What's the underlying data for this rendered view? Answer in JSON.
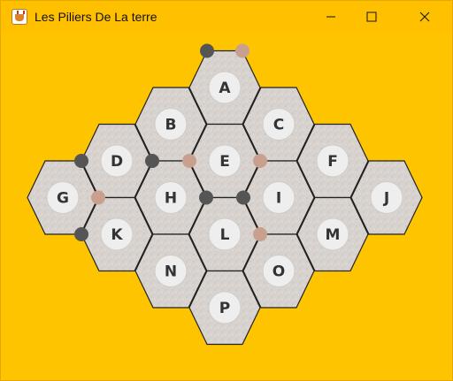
{
  "window": {
    "title": "Les Piliers De La terre",
    "buttons": {
      "minimize": "minimize-icon",
      "maximize": "maximize-icon",
      "close": "close-icon"
    }
  },
  "colors": {
    "titlebar": "#ffc000",
    "background": "#ffc400",
    "hex_fill": "#d9d4d0",
    "hex_stroke": "#222222",
    "circle_fill": "#eeeeee",
    "pillar_dark": "#555555",
    "pillar_light": "#c9a08e"
  },
  "board": {
    "hexes": [
      {
        "id": "A",
        "col": 2,
        "row": 0
      },
      {
        "id": "B",
        "col": 1,
        "row": 1
      },
      {
        "id": "C",
        "col": 3,
        "row": 1
      },
      {
        "id": "D",
        "col": 0,
        "row": 2
      },
      {
        "id": "E",
        "col": 2,
        "row": 2
      },
      {
        "id": "F",
        "col": 4,
        "row": 2
      },
      {
        "id": "G",
        "col": -1,
        "row": 3
      },
      {
        "id": "H",
        "col": 1,
        "row": 3
      },
      {
        "id": "I",
        "col": 3,
        "row": 3
      },
      {
        "id": "J",
        "col": 5,
        "row": 3
      },
      {
        "id": "K",
        "col": 0,
        "row": 4
      },
      {
        "id": "L",
        "col": 2,
        "row": 4
      },
      {
        "id": "M",
        "col": 4,
        "row": 4
      },
      {
        "id": "N",
        "col": 1,
        "row": 5
      },
      {
        "id": "O",
        "col": 3,
        "row": 5
      },
      {
        "id": "P",
        "col": 2,
        "row": 6
      }
    ],
    "pillars": [
      {
        "hex": "A",
        "vertex": "upper-left",
        "color": "dark"
      },
      {
        "hex": "A",
        "vertex": "upper-right",
        "color": "light"
      },
      {
        "hex": "D",
        "vertex": "left",
        "color": "dark"
      },
      {
        "hex": "D",
        "vertex": "right",
        "color": "dark"
      },
      {
        "hex": "E",
        "vertex": "left",
        "color": "light"
      },
      {
        "hex": "E",
        "vertex": "right",
        "color": "light"
      },
      {
        "hex": "G",
        "vertex": "right",
        "color": "light"
      },
      {
        "hex": "K",
        "vertex": "left",
        "color": "dark"
      },
      {
        "hex": "H",
        "vertex": "right",
        "color": "dark"
      },
      {
        "hex": "I",
        "vertex": "left",
        "color": "dark"
      },
      {
        "hex": "L",
        "vertex": "right",
        "color": "light"
      }
    ]
  }
}
